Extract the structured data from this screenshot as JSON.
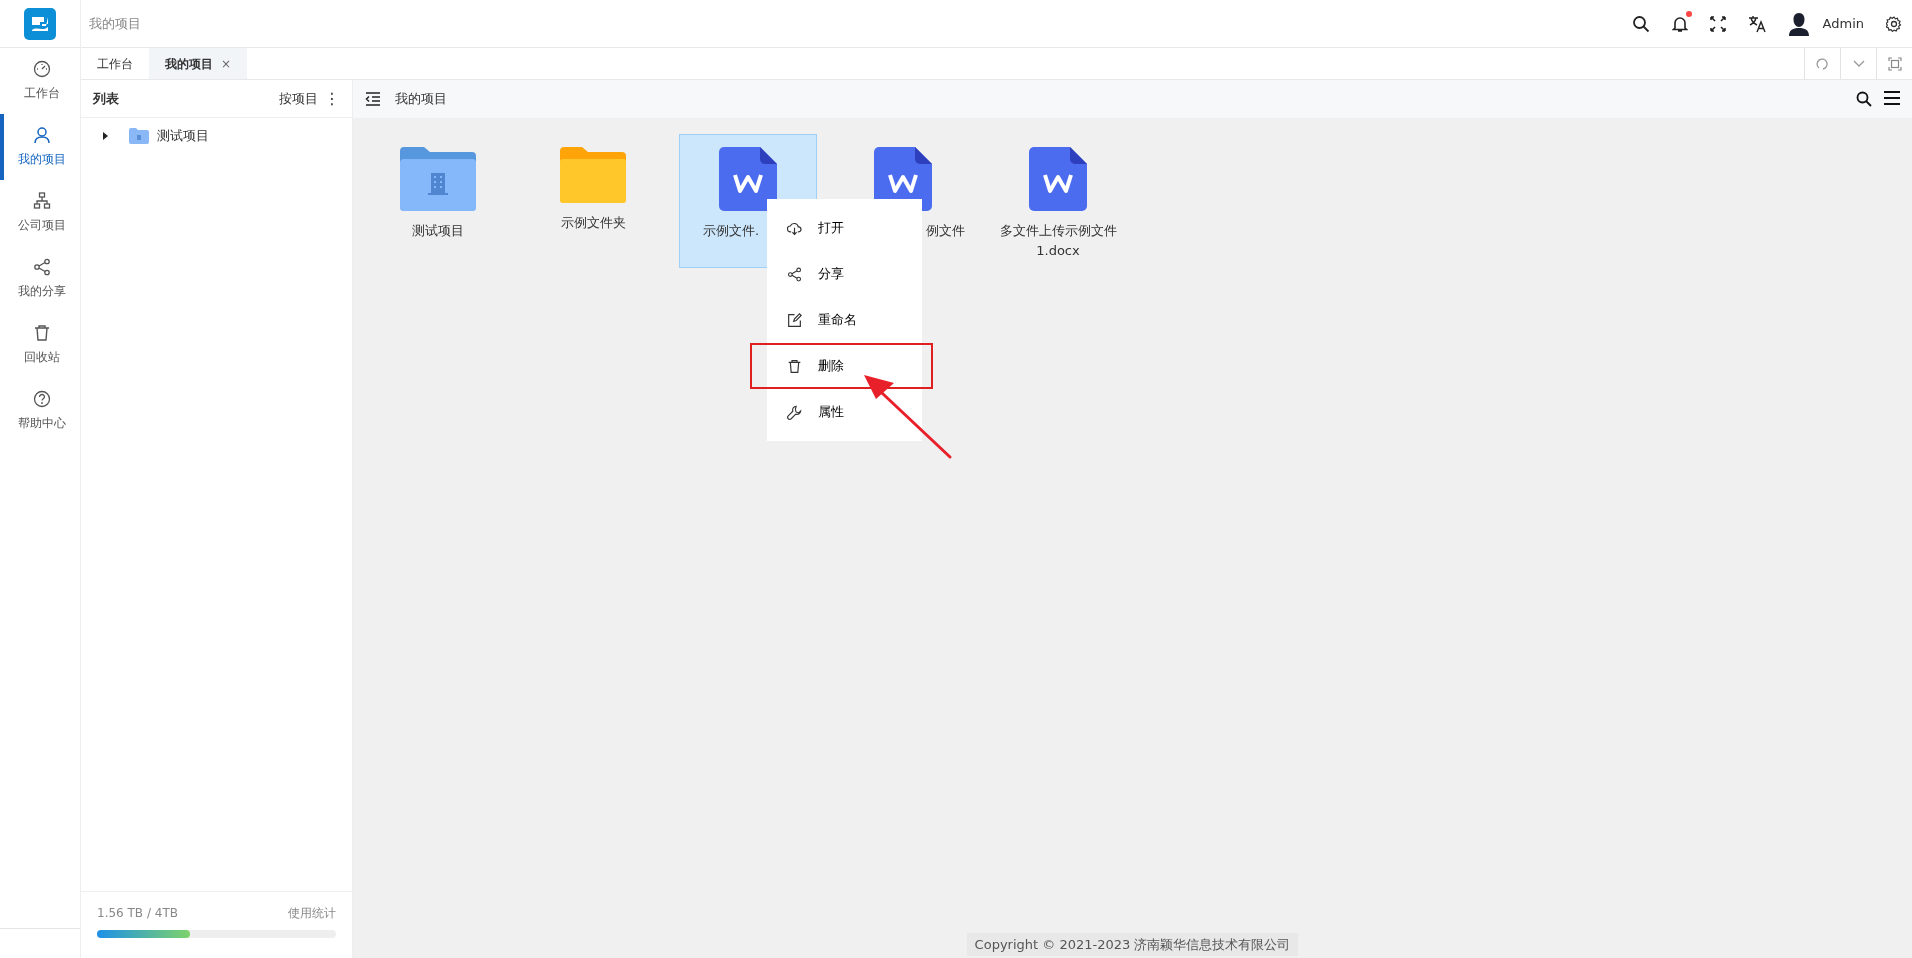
{
  "header": {
    "breadcrumb": "我的项目",
    "notification_dot": true,
    "user": "Admin"
  },
  "rail": [
    {
      "label": "工作台",
      "selected": false
    },
    {
      "label": "我的项目",
      "selected": true
    },
    {
      "label": "公司项目",
      "selected": false
    },
    {
      "label": "我的分享",
      "selected": false
    },
    {
      "label": "回收站",
      "selected": false
    },
    {
      "label": "帮助中心",
      "selected": false
    }
  ],
  "tabs": [
    {
      "label": "工作台",
      "selected": false
    },
    {
      "label": "我的项目",
      "selected": true,
      "close": "×"
    }
  ],
  "panel": {
    "title": "列表",
    "sort": "按项目",
    "more": "⋮",
    "tree": [
      {
        "label": "测试项目",
        "expanded": false
      }
    ],
    "storage": {
      "used": "1.56 TB / 4TB",
      "link": "使用统计",
      "level": 0.39
    }
  },
  "toolbar": {
    "title": "我的项目"
  },
  "files": [
    {
      "kind": "project",
      "name": "测试项目",
      "selected": false
    },
    {
      "kind": "folder",
      "name": "示例文件夹",
      "selected": false
    },
    {
      "kind": "word",
      "name": "示例文件.",
      "selected": true
    },
    {
      "kind": "word",
      "name": "例文件",
      "selected": false
    },
    {
      "kind": "word",
      "name": "多文件上传示例文件1.docx",
      "selected": false
    }
  ],
  "context_menu": {
    "items": [
      {
        "label": "打开",
        "highlighted": false
      },
      {
        "label": "分享",
        "highlighted": false
      },
      {
        "label": "重命名",
        "highlighted": false
      },
      {
        "label": "删除",
        "highlighted": true
      },
      {
        "label": "属性",
        "highlighted": false
      }
    ]
  },
  "footer": "Copyright © 2021-2023 济南颖华信息技术有限公司"
}
